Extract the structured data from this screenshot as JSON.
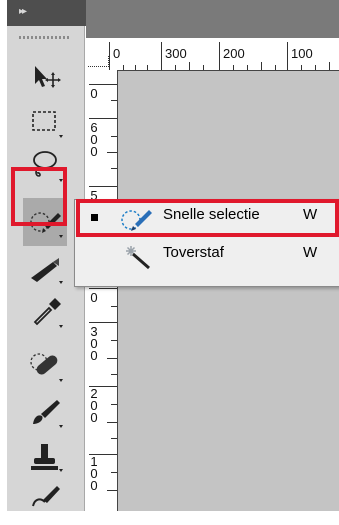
{
  "panel": {
    "collapse_label": "▸▸"
  },
  "ruler": {
    "h_labels": [
      "0",
      "300",
      "200",
      "100"
    ],
    "v_labels": [
      "0",
      "6\n0\n0",
      "5",
      "0",
      "3\n0\n0",
      "2\n0\n0",
      "1\n0\n0"
    ]
  },
  "tools": [
    {
      "name": "move-tool"
    },
    {
      "name": "marquee-tool"
    },
    {
      "name": "lasso-tool"
    },
    {
      "name": "quick-selection-tool",
      "selected": true
    },
    {
      "name": "crop-tool"
    },
    {
      "name": "eyedropper-tool"
    },
    {
      "name": "healing-brush-tool"
    },
    {
      "name": "brush-tool"
    },
    {
      "name": "clone-stamp-tool"
    },
    {
      "name": "history-brush-tool"
    }
  ],
  "flyout": {
    "items": [
      {
        "label": "Snelle selectie",
        "shortcut": "W",
        "active": true,
        "icon": "quick-selection-icon"
      },
      {
        "label": "Toverstaf",
        "shortcut": "W",
        "active": false,
        "icon": "magic-wand-icon"
      }
    ]
  },
  "colors": {
    "highlight": "#e0182c",
    "panel": "#d6d6d6",
    "canvas": "#c4c4c4"
  }
}
